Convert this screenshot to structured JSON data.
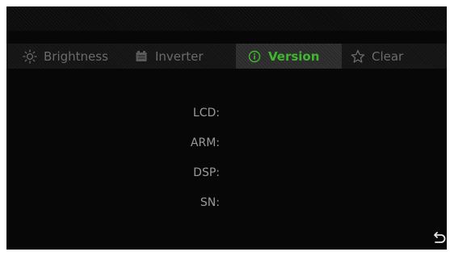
{
  "tabs": {
    "brightness": {
      "label": "Brightness",
      "icon": "sun-icon"
    },
    "inverter": {
      "label": "Inverter",
      "icon": "inverter-icon"
    },
    "version": {
      "label": "Version",
      "icon": "info-icon",
      "active": true
    },
    "clear": {
      "label": "Clear",
      "icon": "star-icon"
    }
  },
  "version_info": {
    "lcd": {
      "label": "LCD:",
      "value": ""
    },
    "arm": {
      "label": "ARM:",
      "value": ""
    },
    "dsp": {
      "label": "DSP:",
      "value": ""
    },
    "sn": {
      "label": "SN:",
      "value": ""
    }
  },
  "back_button": {
    "icon": "back-arrow-icon"
  },
  "colors": {
    "background": "#070707",
    "active_tab_text": "#3fb82e",
    "inactive_tab_text": "#6b6b6b",
    "label_text": "#9a9a9a"
  }
}
